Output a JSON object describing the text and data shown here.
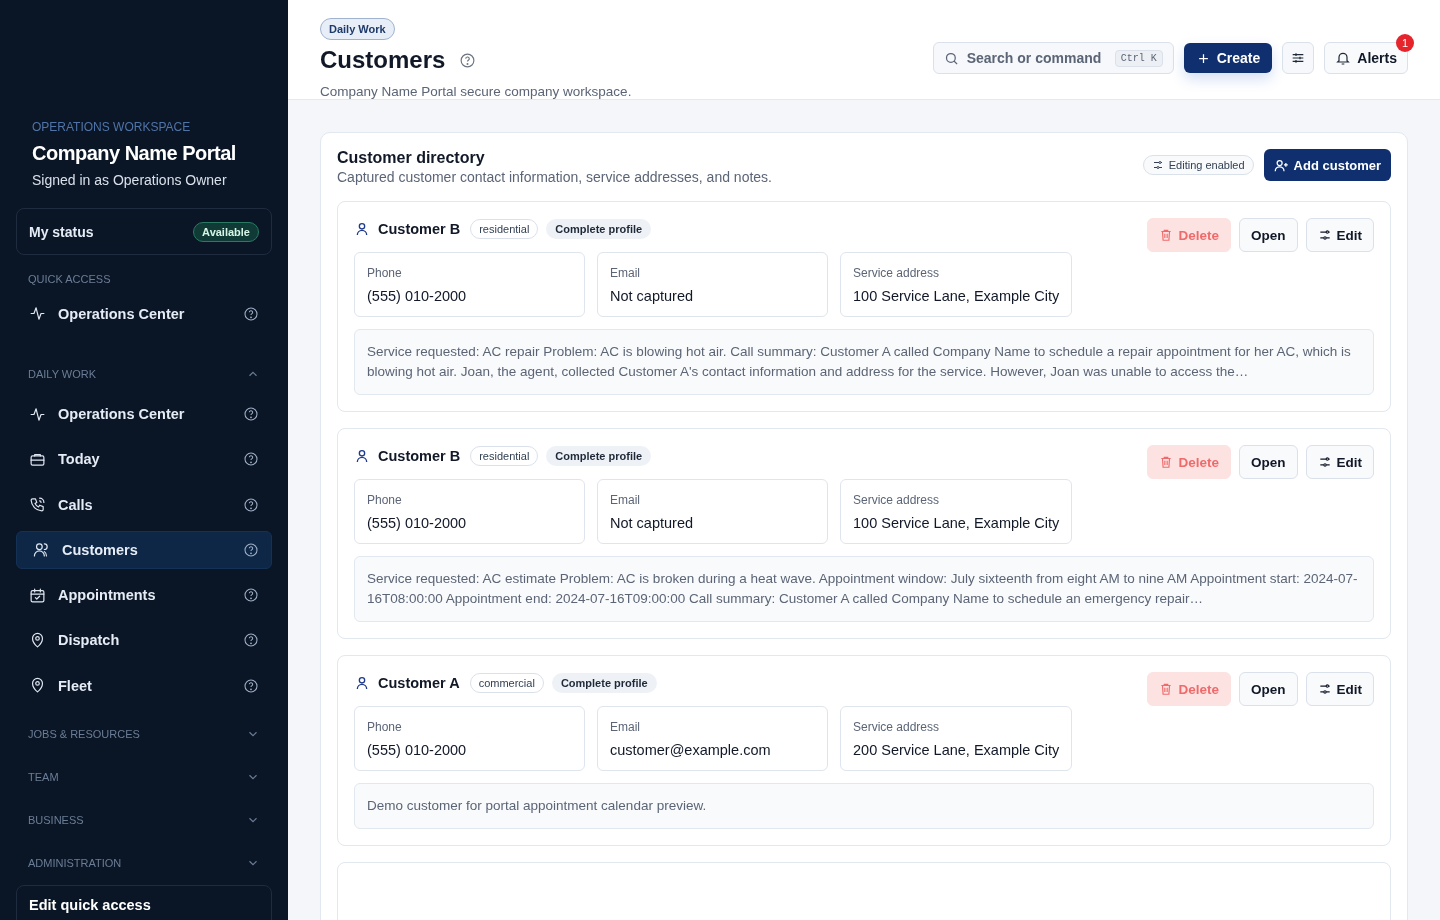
{
  "sidebar": {
    "workspace_label": "OPERATIONS WORKSPACE",
    "portal_name": "Company Name Portal",
    "signed_in": "Signed in as Operations Owner",
    "status": {
      "label": "My status",
      "value": "Available"
    },
    "quick_access": {
      "title": "QUICK ACCESS",
      "items": [
        {
          "label": "Operations Center",
          "selected": false
        }
      ]
    },
    "sections": [
      {
        "title": "DAILY WORK",
        "expanded": true,
        "items": [
          {
            "label": "Operations Center",
            "selected": false
          },
          {
            "label": "Today",
            "selected": false
          },
          {
            "label": "Calls",
            "selected": false
          },
          {
            "label": "Customers",
            "selected": true
          },
          {
            "label": "Appointments",
            "selected": false
          },
          {
            "label": "Dispatch",
            "selected": false
          },
          {
            "label": "Fleet",
            "selected": false
          }
        ]
      },
      {
        "title": "JOBS & RESOURCES",
        "expanded": false
      },
      {
        "title": "TEAM",
        "expanded": false
      },
      {
        "title": "BUSINESS",
        "expanded": false
      },
      {
        "title": "ADMINISTRATION",
        "expanded": false
      }
    ],
    "edit_quick_access": "Edit quick access"
  },
  "header": {
    "breadcrumb": "Daily Work",
    "title": "Customers",
    "subtitle": "Company Name Portal secure company workspace.",
    "search": {
      "placeholder": "Search or command",
      "shortcut": "Ctrl K"
    },
    "create": "Create",
    "alerts": {
      "label": "Alerts",
      "count": "1"
    }
  },
  "directory": {
    "title": "Customer directory",
    "subtitle": "Captured customer contact information, service addresses, and notes.",
    "editing": "Editing enabled",
    "add": "Add customer",
    "customers": [
      {
        "name": "Customer B",
        "type": "residential",
        "profile": "Complete profile",
        "actions": [
          {
            "label": "Delete",
            "kind": "danger"
          },
          {
            "label": "Open",
            "kind": "plain"
          },
          {
            "label": "Edit",
            "kind": "edit"
          }
        ],
        "fields": [
          {
            "label": "Phone",
            "value": "(555) 010-2000"
          },
          {
            "label": "Email",
            "value": "Not captured"
          },
          {
            "label": "Service address",
            "value": "100 Service Lane, Example City"
          }
        ],
        "note": "Service requested: AC repair Problem: AC is blowing hot air. Call summary: Customer A called Company Name to schedule a repair appointment for her AC, which is blowing hot air. Joan, the agent, collected Customer A's contact information and address for the service. However, Joan was unable to access the…"
      },
      {
        "name": "Customer B",
        "type": "residential",
        "profile": "Complete profile",
        "actions": [
          {
            "label": "Delete",
            "kind": "danger"
          },
          {
            "label": "Open",
            "kind": "plain"
          },
          {
            "label": "Edit",
            "kind": "edit"
          }
        ],
        "fields": [
          {
            "label": "Phone",
            "value": "(555) 010-2000"
          },
          {
            "label": "Email",
            "value": "Not captured"
          },
          {
            "label": "Service address",
            "value": "100 Service Lane, Example City"
          }
        ],
        "note": "Service requested: AC estimate Problem: AC is broken during a heat wave. Appointment window: July sixteenth from eight AM to nine AM Appointment start: 2024-07-16T08:00:00 Appointment end: 2024-07-16T09:00:00 Call summary: Customer A called Company Name to schedule an emergency repair…"
      },
      {
        "name": "Customer A",
        "type": "commercial",
        "profile": "Complete profile",
        "actions": [
          {
            "label": "Delete",
            "kind": "danger"
          },
          {
            "label": "Open",
            "kind": "plain"
          },
          {
            "label": "Edit",
            "kind": "edit"
          }
        ],
        "fields": [
          {
            "label": "Phone",
            "value": "(555) 010-2000"
          },
          {
            "label": "Email",
            "value": "customer@example.com"
          },
          {
            "label": "Service address",
            "value": "200 Service Lane, Example City"
          }
        ],
        "note": "Demo customer for portal appointment calendar preview."
      }
    ]
  }
}
